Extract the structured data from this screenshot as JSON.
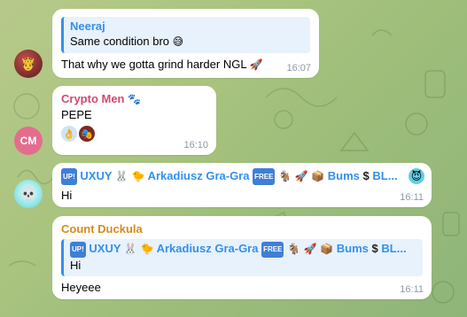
{
  "messages": [
    {
      "id": "m1",
      "reply": {
        "name": "Neeraj",
        "text": "Same condition bro",
        "emoji": "😅"
      },
      "text": "That why we gotta grind harder NGL",
      "text_emoji": "🚀",
      "time": "16:07"
    },
    {
      "id": "m2",
      "sender": "Crypto Men",
      "sender_emoji": "🐾",
      "sender_color": "#d24a6e",
      "text": "PEPE",
      "reactions": [
        "👌",
        "🎭"
      ],
      "time": "16:10",
      "avatar_initials": "CM",
      "avatar_color": "#e46d8e"
    },
    {
      "id": "m3",
      "title_parts": [
        "UXUY",
        "Arkadiusz Gra-Gra",
        "Bums",
        "BL..."
      ],
      "text": "Hi",
      "time": "16:11"
    },
    {
      "id": "m4",
      "sender": "Count Duckula",
      "sender_color": "#d98a1a",
      "reply": {
        "title_parts": [
          "UXUY",
          "Arkadiusz Gra-Gra",
          "Bums",
          "BL..."
        ],
        "text": "Hi"
      },
      "text": "Heyeee",
      "time": "16:11"
    }
  ],
  "colors": {
    "link": "#3390ec",
    "accent_orange": "#d98a1a",
    "accent_pink": "#d24a6e"
  }
}
